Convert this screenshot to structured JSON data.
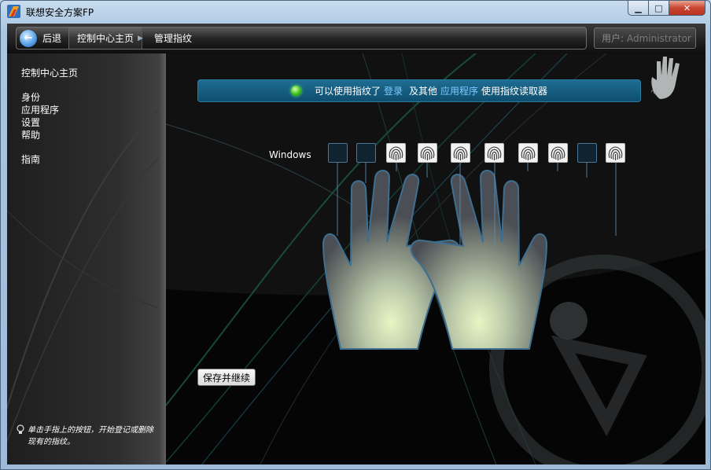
{
  "window": {
    "title": "联想安全方案FP",
    "min_glyph": "▁",
    "max_glyph": "□",
    "close_glyph": "✕"
  },
  "nav": {
    "back_label": "后退",
    "back_arrow": "←",
    "breadcrumb_home": "控制中心主页",
    "breadcrumb_sep": "▶",
    "breadcrumb_current": "管理指纹",
    "user_prefix": "用户:",
    "user_name": "Administrator"
  },
  "sidebar": {
    "home": "控制中心主页",
    "identity": "身份",
    "apps": "应用程序",
    "settings": "设置",
    "help": "帮助",
    "guide": "指南",
    "hint_icon": "lightbulb-icon",
    "hint_text": "单击手指上的按钮，开始登记或删除现有的指纹。"
  },
  "status": {
    "text_1": "可以使用指纹了",
    "link_login": "登录",
    "text_2": "及其他",
    "link_apps": "应用程序",
    "text_3": "使用指纹读取器",
    "indicator_color": "#3fc21a"
  },
  "fingers": {
    "label": "Windows",
    "enrolled": [
      false,
      false,
      true,
      true,
      true,
      true,
      true,
      true,
      false,
      true
    ]
  },
  "actions": {
    "save_continue": "保存并继续"
  },
  "colors": {
    "accent": "#1e6d92",
    "link": "#7ec9ff",
    "hand_glow": "#e9f5c4"
  }
}
